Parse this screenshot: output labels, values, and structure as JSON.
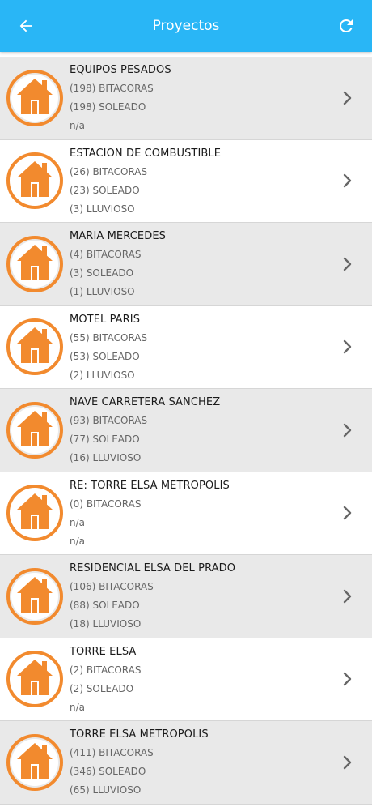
{
  "header": {
    "title": "Proyectos",
    "back_icon": "arrow-left-icon",
    "refresh_icon": "refresh-icon",
    "color": "#29b6f6"
  },
  "projects": [
    {
      "name": "EQUIPOS PESADOS",
      "line1": "(198) BITACORAS",
      "line2": "(198) SOLEADO",
      "line3": "n/a"
    },
    {
      "name": "ESTACION DE COMBUSTIBLE",
      "line1": "(26) BITACORAS",
      "line2": "(23) SOLEADO",
      "line3": "(3) LLUVIOSO"
    },
    {
      "name": "MARIA MERCEDES",
      "line1": "(4) BITACORAS",
      "line2": "(3) SOLEADO",
      "line3": "(1) LLUVIOSO"
    },
    {
      "name": "MOTEL PARIS",
      "line1": "(55) BITACORAS",
      "line2": "(53) SOLEADO",
      "line3": "(2) LLUVIOSO"
    },
    {
      "name": "NAVE CARRETERA SANCHEZ",
      "line1": "(93) BITACORAS",
      "line2": "(77) SOLEADO",
      "line3": "(16) LLUVIOSO"
    },
    {
      "name": "RE: TORRE ELSA METROPOLIS",
      "line1": "(0) BITACORAS",
      "line2": "n/a",
      "line3": "n/a"
    },
    {
      "name": "RESIDENCIAL ELSA DEL PRADO",
      "line1": "(106) BITACORAS",
      "line2": "(88) SOLEADO",
      "line3": "(18) LLUVIOSO"
    },
    {
      "name": "TORRE ELSA",
      "line1": "(2) BITACORAS",
      "line2": "(2) SOLEADO",
      "line3": "n/a"
    },
    {
      "name": "TORRE ELSA METROPOLIS",
      "line1": "(411) BITACORAS",
      "line2": "(346) SOLEADO",
      "line3": "(65) LLUVIOSO"
    }
  ],
  "icons": {
    "avatar": "house-icon",
    "chevron": "chevron-right-icon"
  },
  "colors": {
    "accent": "#f28a2e",
    "row_shaded": "#e9e9e9"
  }
}
